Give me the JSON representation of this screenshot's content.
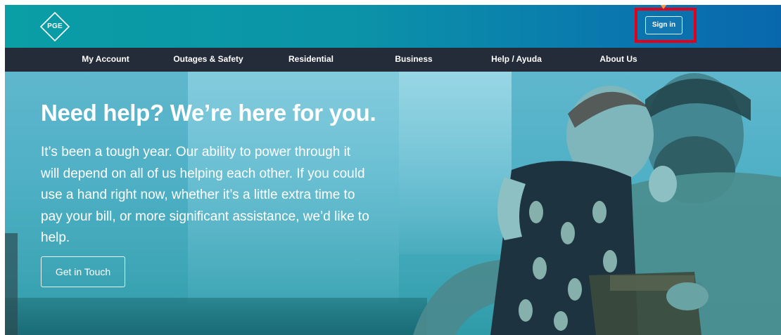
{
  "header": {
    "logo_text": "PGE",
    "sign_in_label": "Sign in"
  },
  "nav": {
    "items": [
      {
        "label": "My Account"
      },
      {
        "label": "Outages & Safety"
      },
      {
        "label": "Residential"
      },
      {
        "label": "Business"
      },
      {
        "label": "Help / Ayuda"
      },
      {
        "label": "About Us"
      }
    ]
  },
  "hero": {
    "heading": "Need help? We’re here for you.",
    "body": "It’s been a tough year. Our ability to power through it will depend on all of us helping each other. If you could use a hand right now, whether it’s a little extra time to pay your bill, or more significant assistance, we’d like to help.",
    "cta_label": "Get in Touch"
  },
  "icons": {
    "logo": "pge-diamond-logo",
    "pointer": "pointer-marker"
  },
  "colors": {
    "highlight": "#e3001b",
    "pointer": "#f39a4d",
    "nav_bg": "#242c3a",
    "topbar_start": "#0a9ea5",
    "topbar_end": "#0968ad"
  }
}
